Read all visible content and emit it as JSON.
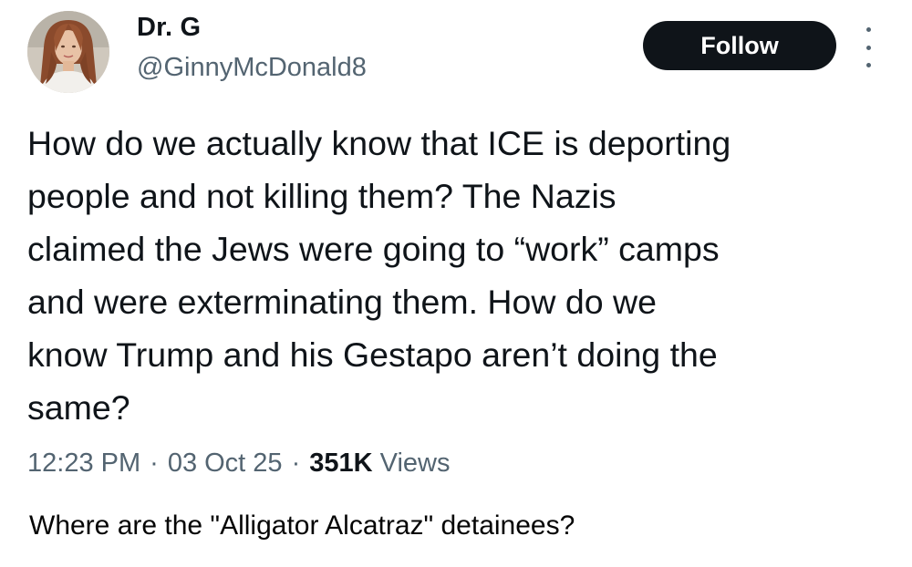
{
  "tweet": {
    "author": {
      "display_name": "Dr. G",
      "handle": "@GinnyMcDonald8"
    },
    "follow_label": "Follow",
    "more_icon": "more-vertical-icon",
    "text": "How do we actually know that ICE is deporting\npeople and not killing them? The Nazis\nclaimed the Jews were going to “work” camps\nand were exterminating them. How do we\nknow Trump and his Gestapo aren’t doing the\nsame?",
    "time": "12:23 PM",
    "date": "03 Oct 25",
    "separator": "·",
    "views_count": "351K",
    "views_label": "Views"
  },
  "caption": "Where are the \"Alligator Alcatraz\" detainees?",
  "colors": {
    "text_primary": "#0f1419",
    "text_secondary": "#536471",
    "follow_button_bg": "#0f1419",
    "follow_button_text": "#ffffff"
  }
}
